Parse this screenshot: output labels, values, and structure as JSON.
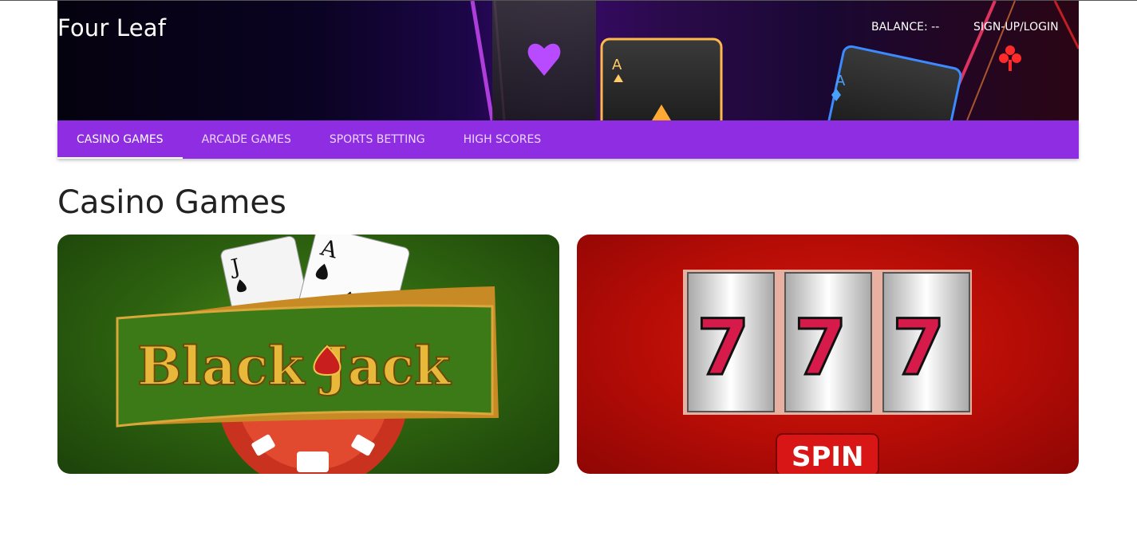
{
  "header": {
    "brand": "Four Leaf",
    "balance_label": "BALANCE: --",
    "login_label": "SIGN-UP/LOGIN"
  },
  "nav": {
    "tabs": [
      {
        "label": "CASINO GAMES",
        "active": true
      },
      {
        "label": "ARCADE GAMES",
        "active": false
      },
      {
        "label": "SPORTS BETTING",
        "active": false
      },
      {
        "label": "HIGH SCORES",
        "active": false
      }
    ]
  },
  "main": {
    "title": "Casino Games",
    "games": [
      {
        "logo_text": "Black Jack",
        "card_ranks": [
          "J",
          "A"
        ]
      },
      {
        "reels": [
          "7",
          "7",
          "7"
        ],
        "spin_label": "SPIN"
      }
    ]
  },
  "colors": {
    "nav_bg": "#8e2de2",
    "blackjack_bg": "#2f6510",
    "slots_bg": "#b50c06"
  }
}
